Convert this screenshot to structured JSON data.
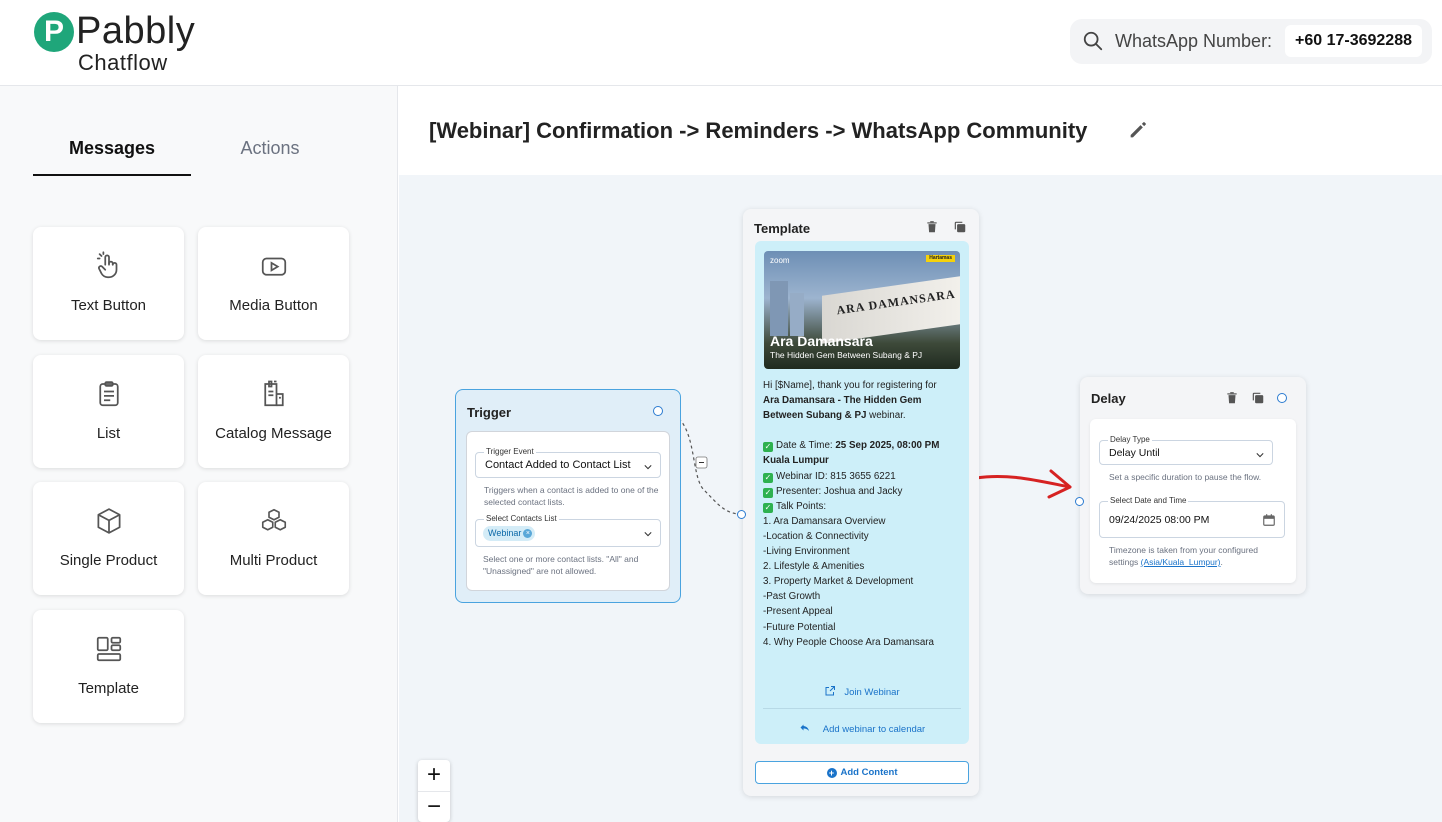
{
  "brand": {
    "logo_letter": "P",
    "name": "Pabbly",
    "product": "Chatflow"
  },
  "header": {
    "whatsapp_label": "WhatsApp Number:",
    "whatsapp_number": "+60 17-3692288"
  },
  "sidebar": {
    "tabs": [
      {
        "label": "Messages",
        "active": true
      },
      {
        "label": "Actions",
        "active": false
      }
    ],
    "items": [
      {
        "label": "Text Button",
        "icon": "tap-hand-icon"
      },
      {
        "label": "Media Button",
        "icon": "play-button-icon"
      },
      {
        "label": "List",
        "icon": "clipboard-list-icon"
      },
      {
        "label": "Catalog Message",
        "icon": "catalog-icon"
      },
      {
        "label": "Single Product",
        "icon": "cube-icon"
      },
      {
        "label": "Multi Product",
        "icon": "cubes-icon"
      },
      {
        "label": "Template",
        "icon": "template-layout-icon"
      }
    ]
  },
  "flow": {
    "title": "[Webinar] Confirmation -> Reminders -> WhatsApp Community"
  },
  "trigger": {
    "title": "Trigger",
    "event_label": "Trigger Event",
    "event_value": "Contact Added to Contact List",
    "event_hint": "Triggers when a contact is added to one of the selected contact lists.",
    "lists_label": "Select Contacts List",
    "lists_chip": "Webinar",
    "lists_hint": "Select one or more contact lists. \"All\" and \"Unassigned\" are not allowed."
  },
  "template": {
    "title": "Template",
    "image": {
      "zoom_text": "zoom",
      "tag": "Hartamas",
      "wall_text": "ARA DAMANSARA",
      "title": "Ara Damansara",
      "subtitle": "The Hidden Gem Between Subang & PJ"
    },
    "greeting": "Hi [$Name], thank you for registering for",
    "webinar_name": "Ara Damansara - The Hidden Gem Between Subang & PJ",
    "webinar_suffix": " webinar.",
    "date_label": "Date & Time: ",
    "date_value": "25 Sep 2025, 08:00 PM Kuala Lumpur",
    "webinar_id": "Webinar ID: 815 3655 6221",
    "presenter": "Presenter: Joshua and Jacky",
    "talk_points_label": "Talk Points:",
    "talk_points": [
      "1. Ara Damansara Overview",
      "-Location & Connectivity",
      "-Living Environment",
      "2. Lifestyle & Amenities",
      "3. Property Market & Development",
      "-Past Growth",
      "-Present Appeal",
      "-Future Potential",
      "4. Why People Choose Ara Damansara"
    ],
    "button_join": "Join Webinar",
    "button_calendar": "Add webinar to calendar",
    "add_content": "Add Content"
  },
  "delay": {
    "title": "Delay",
    "type_label": "Delay Type",
    "type_value": "Delay Until",
    "type_hint": "Set a specific duration to pause the flow.",
    "date_label": "Select Date and Time",
    "date_value": "09/24/2025 08:00 PM",
    "tz_hint": "Timezone is taken from your configured settings",
    "tz_link": "(Asia/Kuala_Lumpur)",
    "tz_end": "."
  },
  "zoom": {
    "in": "+",
    "out": "−"
  },
  "colors": {
    "accent": "#1a73c9",
    "brand_green": "#1fa67a",
    "trigger_border": "#4aa3df",
    "bubble": "#cdeff9",
    "annotation_arrow": "#d62222"
  }
}
